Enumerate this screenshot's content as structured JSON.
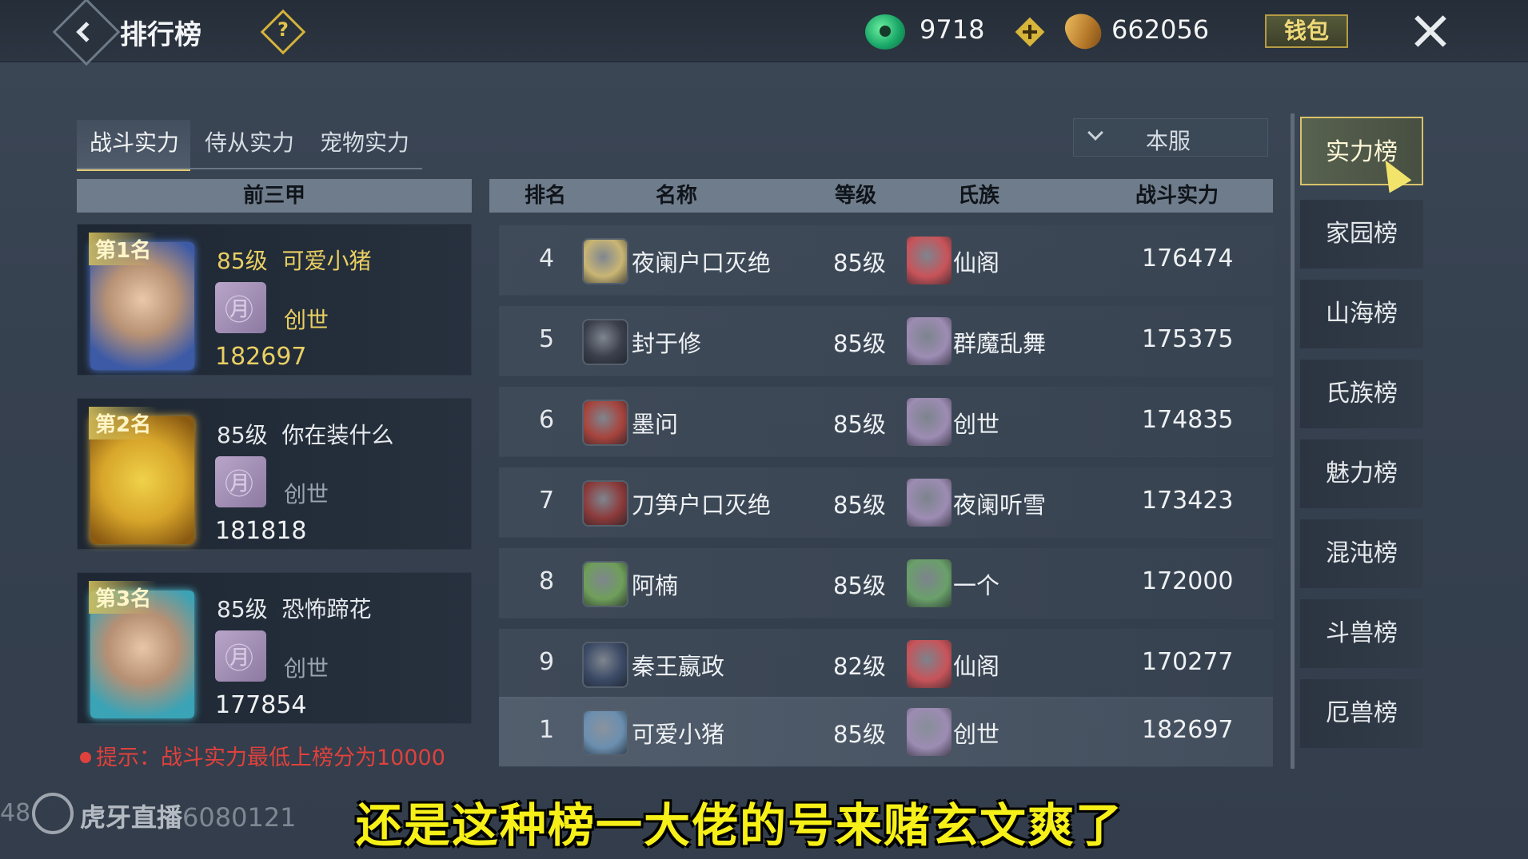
{
  "header": {
    "title": "排行榜",
    "help_icon": "question-diamond-icon",
    "jade_value": "9718",
    "gold_value": "662056",
    "wallet_label": "钱包"
  },
  "tabs": [
    "战斗实力",
    "侍从实力",
    "宠物实力"
  ],
  "server_select": "本服",
  "top3": {
    "header": "前三甲",
    "cards": [
      {
        "rank_label": "第1名",
        "level": "85级",
        "name": "可爱小猪",
        "clan": "创世",
        "power": "182697"
      },
      {
        "rank_label": "第2名",
        "level": "85级",
        "name": "你在装什么",
        "clan": "创世",
        "power": "181818"
      },
      {
        "rank_label": "第3名",
        "level": "85级",
        "name": "恐怖蹄花",
        "clan": "创世",
        "power": "177854"
      }
    ]
  },
  "hint": "提示：战斗实力最低上榜分为10000",
  "table": {
    "headers": {
      "rank": "排名",
      "name": "名称",
      "level": "等级",
      "clan": "氏族",
      "power": "战斗实力"
    },
    "rows": [
      {
        "rank": "4",
        "name": "夜阑户口灭绝",
        "level": "85级",
        "clan": "仙阁",
        "power": "176474",
        "clan_color": "#c8545a",
        "avatar_color": "#c9b574"
      },
      {
        "rank": "5",
        "name": "封于修",
        "level": "85级",
        "clan": "群魔乱舞",
        "power": "175375",
        "clan_color": "#9d8cb3",
        "avatar_color": "#3b3f4c"
      },
      {
        "rank": "6",
        "name": "墨问",
        "level": "85级",
        "clan": "创世",
        "power": "174835",
        "clan_color": "#9d8cb3",
        "avatar_color": "#a7443d"
      },
      {
        "rank": "7",
        "name": "刀笋户口灭绝",
        "level": "85级",
        "clan": "夜阑听雪",
        "power": "173423",
        "clan_color": "#9d8cb3",
        "avatar_color": "#8c3a3a"
      },
      {
        "rank": "8",
        "name": "阿楠",
        "level": "85级",
        "clan": "一个",
        "power": "172000",
        "clan_color": "#6aa06a",
        "avatar_color": "#6f9f5a"
      },
      {
        "rank": "9",
        "name": "秦王嬴政",
        "level": "82级",
        "clan": "仙阁",
        "power": "170277",
        "clan_color": "#c8545a",
        "avatar_color": "#3c4a66"
      }
    ],
    "self_row": {
      "rank": "1",
      "name": "可爱小猪",
      "level": "85级",
      "clan": "创世",
      "power": "182697",
      "clan_color": "#9d8cb3",
      "avatar_color": "#6b8fb0"
    }
  },
  "side_menu": [
    "实力榜",
    "家园榜",
    "山海榜",
    "氏族榜",
    "魅力榜",
    "混沌榜",
    "斗兽榜",
    "厄兽榜"
  ],
  "overlay": {
    "watermark_left": "48",
    "watermark_brand": "虎牙直播",
    "watermark_id": "6080121",
    "subtitle": "还是这种榜一大佬的号来赌玄文爽了"
  }
}
